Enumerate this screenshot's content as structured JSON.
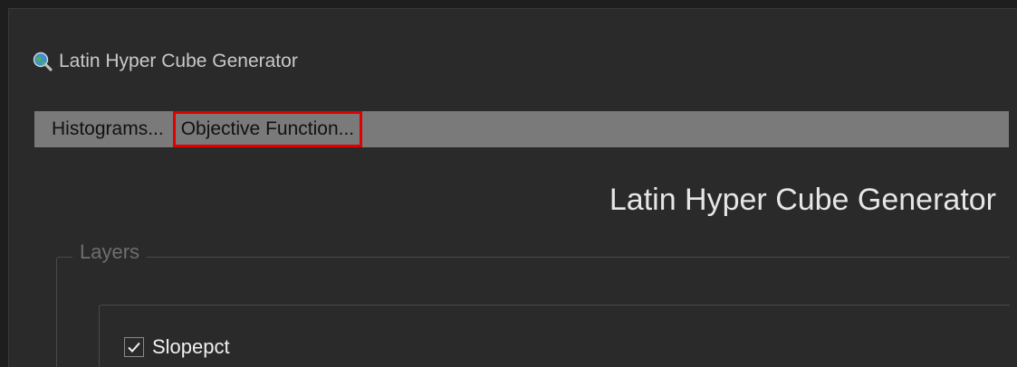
{
  "window": {
    "title": "Latin Hyper Cube Generator",
    "icon": "magnifier-globe-icon"
  },
  "menubar": {
    "items": [
      {
        "label": "Histograms..."
      },
      {
        "label": "Objective Function..."
      }
    ],
    "highlight_color": "#e00000"
  },
  "main": {
    "heading": "Latin Hyper Cube Generator"
  },
  "layers": {
    "legend": "Layers",
    "items": [
      {
        "label": "Slopepct",
        "checked": true
      }
    ]
  }
}
